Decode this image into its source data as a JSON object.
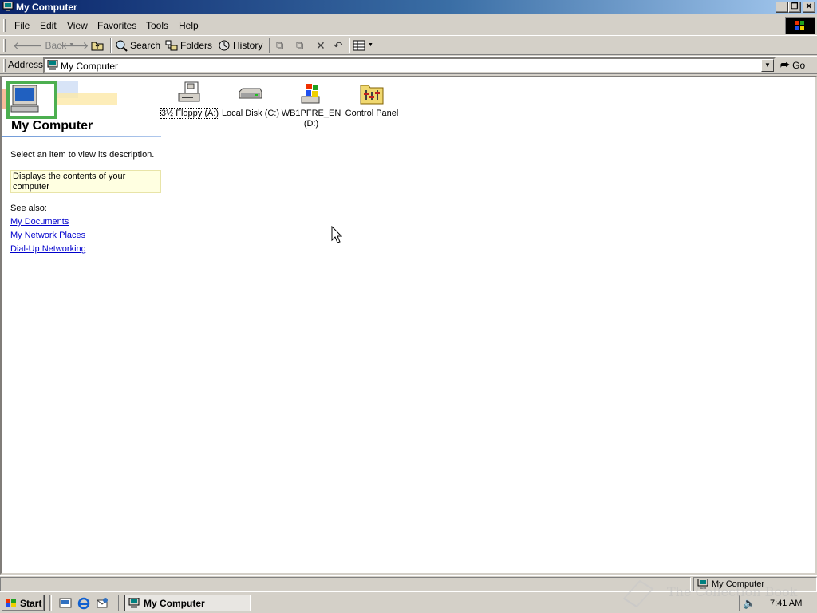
{
  "window": {
    "title": "My Computer",
    "menu": [
      "File",
      "Edit",
      "View",
      "Favorites",
      "Tools",
      "Help"
    ],
    "toolbar": {
      "back": "Back",
      "search": "Search",
      "folders": "Folders",
      "history": "History"
    },
    "address": {
      "label": "Address",
      "value": "My Computer",
      "go": "Go"
    }
  },
  "left_panel": {
    "title": "My Computer",
    "description": "Select an item to view its description.",
    "info": "Displays the contents of your computer",
    "see_also": "See also:",
    "links": [
      "My Documents",
      "My Network Places",
      "Dial-Up Networking"
    ]
  },
  "items": [
    {
      "label": "3½ Floppy (A:)",
      "icon": "floppy-drive-icon",
      "selected": true
    },
    {
      "label": "Local Disk (C:)",
      "icon": "hard-disk-icon",
      "selected": false
    },
    {
      "label": "WB1PFRE_EN (D:)",
      "icon": "cd-drive-icon",
      "selected": false
    },
    {
      "label": "Control Panel",
      "icon": "control-panel-icon",
      "selected": false
    }
  ],
  "status": {
    "location": "My Computer"
  },
  "taskbar": {
    "start": "Start",
    "task": "My Computer",
    "clock": "7:41 AM"
  },
  "watermark": "The Collection Book",
  "colors": {
    "title_start": "#0a246a",
    "title_end": "#a6caf0",
    "link": "#0000cc",
    "face": "#d4d0c8",
    "info_bg": "#ffffe1"
  }
}
